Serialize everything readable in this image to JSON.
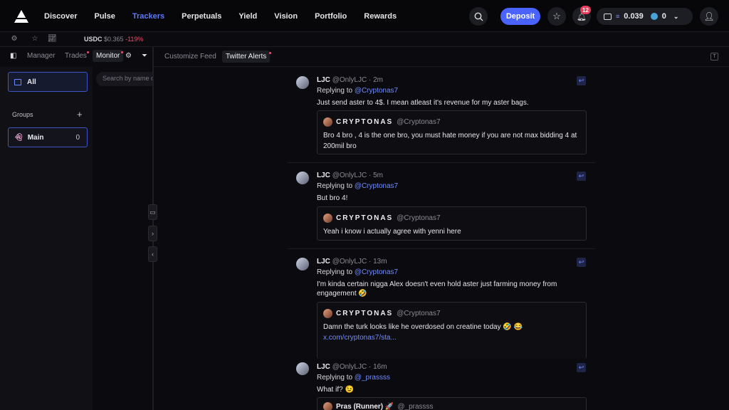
{
  "nav": {
    "items": [
      "Discover",
      "Pulse",
      "Trackers",
      "Perpetuals",
      "Yield",
      "Vision",
      "Portfolio",
      "Rewards"
    ],
    "active": "Trackers"
  },
  "header": {
    "deposit_label": "Deposit",
    "notification_count": "12",
    "sol_balance": "0.039",
    "token_count": "0"
  },
  "ticker": {
    "symbol": "USDC",
    "price": "$0.365",
    "change": "-119%"
  },
  "left_tabs": {
    "manager": "Manager",
    "trades": "Trades",
    "monitor": "Monitor"
  },
  "sidebar": {
    "all_label": "All",
    "groups_label": "Groups",
    "group_name": "Main",
    "group_count": "0"
  },
  "search": {
    "placeholder": "Search by name or..."
  },
  "feed_tabs": {
    "customize": "Customize Feed",
    "twitter": "Twitter Alerts"
  },
  "tweets": [
    {
      "name": "LJC",
      "meta": "@OnlyLJC · 2m",
      "replying_prefix": "Replying to ",
      "replying_to": "@Cryptonas7",
      "text": "Just send aster to 4$. I mean atleast it's revenue for my aster bags.",
      "quote_name": "CRYPTONAS",
      "quote_handle": "@Cryptonas7",
      "quote_text": "Bro 4 bro , 4 is the one bro, you must hate money if you are not max bidding 4 at 200mil bro"
    },
    {
      "name": "LJC",
      "meta": "@OnlyLJC · 5m",
      "replying_prefix": "Replying to ",
      "replying_to": "@Cryptonas7",
      "text": "But bro 4!",
      "quote_name": "CRYPTONAS",
      "quote_handle": "@Cryptonas7",
      "quote_text": "Yeah i know i actually agree with yenni here"
    },
    {
      "name": "LJC",
      "meta": "@OnlyLJC · 13m",
      "replying_prefix": "Replying to ",
      "replying_to": "@Cryptonas7",
      "text": "I'm kinda certain nigga Alex doesn't even hold aster just farming money from engagement 🤣",
      "quote_name": "CRYPTONAS",
      "quote_handle": "@Cryptonas7",
      "quote_text": "Damn the turk looks like he overdosed on creatine today 🤣 😂",
      "quote_link": "x.com/cryptonas7/sta..."
    },
    {
      "name": "LJC",
      "meta": "@OnlyLJC · 16m",
      "replying_prefix": "Replying to ",
      "replying_to": "@_prassss",
      "text": "What if? 😉",
      "quote_name": "Pras (Runner) 🚀",
      "quote_handle": "@_prassss"
    }
  ]
}
